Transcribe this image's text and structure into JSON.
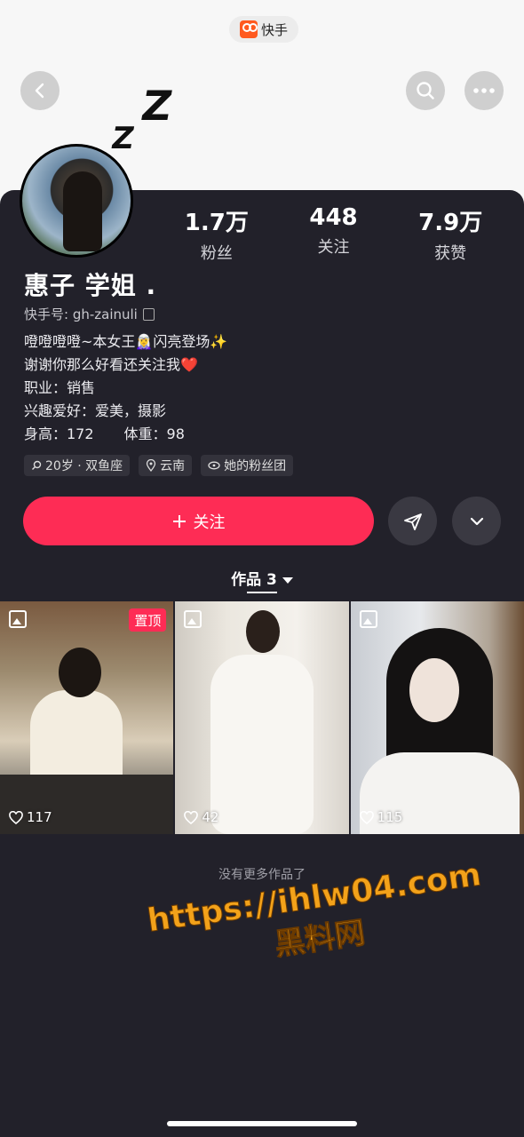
{
  "app": {
    "brand": "快手"
  },
  "header": {
    "back_icon": "chevron-left-icon",
    "search_icon": "search-icon",
    "more_icon": "more-dots-icon",
    "decoration": [
      "Z",
      "Z"
    ]
  },
  "profile": {
    "stats": [
      {
        "value": "1.7万",
        "label": "粉丝"
      },
      {
        "value": "448",
        "label": "关注"
      },
      {
        "value": "7.9万",
        "label": "获赞"
      }
    ],
    "name": "惠子 学姐 .",
    "kuaishou_id": "快手号: gh-zainuli",
    "bio": [
      "噔噔噔噔~本女王🧝‍♀️闪亮登场✨",
      "谢谢你那么好看还关注我❤️",
      "职业：销售",
      "兴趣爱好：爱美，摄影"
    ],
    "body_height": "身高：172",
    "body_weight": "体重：98",
    "tags": [
      "20岁 · 双鱼座",
      "云南",
      "她的粉丝团"
    ]
  },
  "actions": {
    "follow_label": "关注",
    "follow_color": "#fe2c55"
  },
  "works": {
    "tab_label": "作品 3",
    "items": [
      {
        "pinned": "置顶",
        "likes": "117"
      },
      {
        "likes": "42"
      },
      {
        "likes": "115"
      }
    ],
    "no_more": "没有更多作品了"
  },
  "watermark": {
    "url": "https://ihlw04.com",
    "name": "黑料网"
  }
}
